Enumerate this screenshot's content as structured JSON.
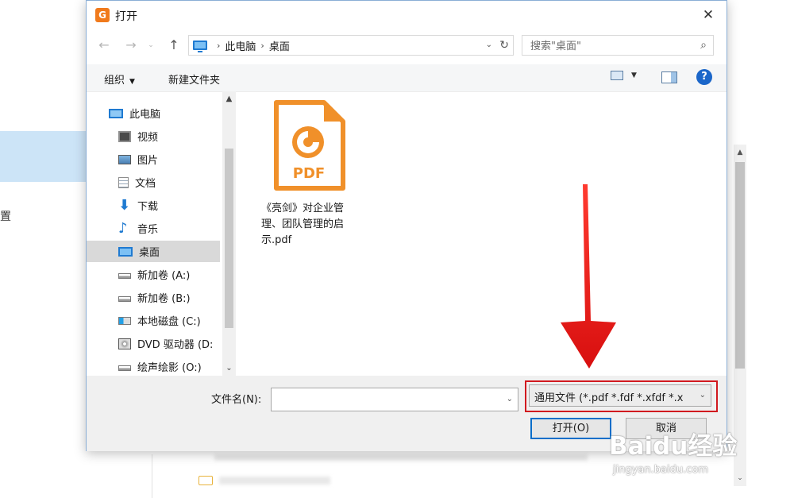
{
  "background": {
    "side_char": "置"
  },
  "dialog": {
    "title": "打开",
    "address": {
      "crumbs": [
        "此电脑",
        "桌面"
      ]
    },
    "search": {
      "placeholder": "搜索\"桌面\""
    },
    "toolbar": {
      "organize": "组织",
      "new_folder": "新建文件夹"
    },
    "nav_items": [
      {
        "label": "此电脑",
        "icon": "computer-icon"
      },
      {
        "label": "视频",
        "icon": "video-icon"
      },
      {
        "label": "图片",
        "icon": "picture-icon"
      },
      {
        "label": "文档",
        "icon": "document-icon"
      },
      {
        "label": "下载",
        "icon": "download-icon"
      },
      {
        "label": "音乐",
        "icon": "music-icon"
      },
      {
        "label": "桌面",
        "icon": "desktop-icon",
        "selected": true
      },
      {
        "label": "新加卷 (A:)",
        "icon": "drive-icon"
      },
      {
        "label": "新加卷 (B:)",
        "icon": "drive-icon"
      },
      {
        "label": "本地磁盘 (C:)",
        "icon": "system-drive-icon"
      },
      {
        "label": "DVD 驱动器 (D:",
        "icon": "dvd-icon"
      },
      {
        "label": "绘声绘影 (O:)",
        "icon": "drive-icon"
      }
    ],
    "files": [
      {
        "name": "《亮剑》对企业管理、团队管理的启示.pdf",
        "icon_text": "PDF"
      }
    ],
    "filename_label": "文件名(N):",
    "filename_value": "",
    "filetype": "通用文件 (*.pdf *.fdf *.xfdf *.x",
    "open_button": "打开(O)",
    "cancel_button": "取消"
  },
  "watermark": {
    "logo": "Baidu经验",
    "url": "jingyan.baidu.com"
  },
  "colors": {
    "accent": "#1b66c9",
    "pdf_orange": "#f0902a",
    "annotation_red": "#e11b1b",
    "selection": "#d9d9d9"
  }
}
